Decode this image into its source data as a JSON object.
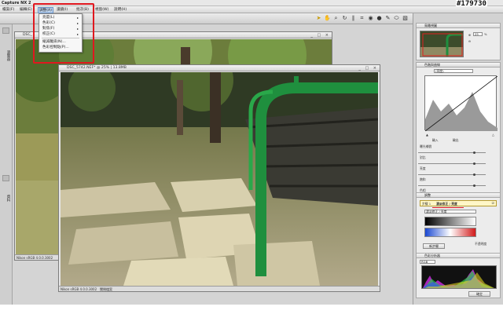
{
  "app": {
    "title": "Capture NX 2",
    "watermark": "#179730"
  },
  "menu": {
    "items": [
      "檔案(F)",
      "編輯(E)",
      "調整(A)",
      "濾鏡(I)",
      "批次(B)",
      "視窗(W)",
      "說明(H)"
    ],
    "active_index": 2
  },
  "dropdown": {
    "items": [
      {
        "label": "亮度(L)",
        "has_sub": true
      },
      {
        "label": "色彩(C)",
        "has_sub": true
      },
      {
        "label": "對焦(F)",
        "has_sub": true
      },
      {
        "label": "校正(C)",
        "has_sub": true
      },
      {
        "label": "縮減雜訊(N)...",
        "has_sub": false
      },
      {
        "label": "色彩控制點(P)...",
        "has_sub": false
      }
    ]
  },
  "left_tabs": [
    "瀏覽器",
    "資料"
  ],
  "windows": {
    "back_title": "DSC_",
    "back_status": "Nikon sRGB 4.0.0.3002",
    "front_title": "DSC_5742.NEF* @ 25% | 13.8MB",
    "front_status": "Nikon sRGB 4.0.0.3002",
    "front_status_right": "關閉檔案"
  },
  "right_panel": {
    "birdseye_title": "鳥瞰視圖",
    "zoom_value": "25",
    "zoom_unit": "%",
    "levels_title": "色階與曲線",
    "channel_select": "(亮度)",
    "input_label": "輸入",
    "output_label": "輸出",
    "adj_labels": [
      "曝光補償",
      "對比",
      "亮度",
      "飽和",
      "色相"
    ],
    "adjust_title": "調整",
    "step_label": "步驟 1",
    "step_item": "濃淡修正 / 亮度",
    "blend_label": "濃淡修正 / 亮度",
    "opacity_labels": [
      "不透明度"
    ],
    "apply_btn": "新步驟",
    "histogram_title": "色彩分析器",
    "channel_label": "RGB",
    "ok_btn": "確定"
  },
  "colors": {
    "highlight": "#e0181f",
    "menu_active": "#bcd3ee"
  }
}
